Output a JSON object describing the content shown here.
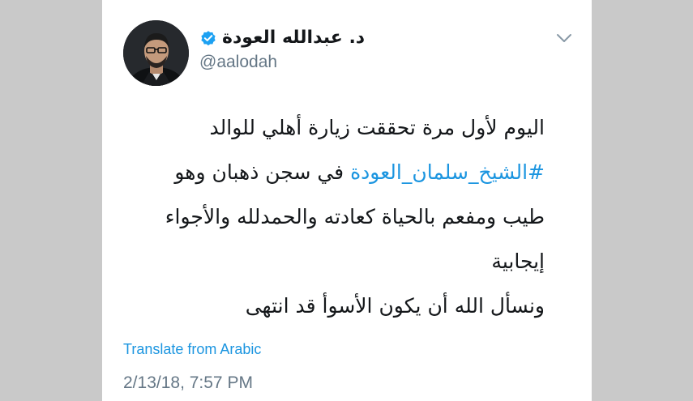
{
  "tweet": {
    "author_name": "د. عبدالله العودة",
    "handle": "@aalodah",
    "lines": [
      {
        "text": "اليوم لأول مرة تحققت زيارة أهلي للوالد"
      },
      {
        "hashtag": "#الشيخ_سلمان_العودة",
        "text": " في سجن ذهبان وهو"
      },
      {
        "text": "طيب ومفعم بالحياة كعادته والحمدلله والأجواء"
      },
      {
        "text": "إيجابية"
      },
      {
        "text": "ونسأل الله أن يكون الأسوأ قد انتهى"
      }
    ],
    "translate_label": "Translate from Arabic",
    "timestamp": "2/13/18, 7:57 PM"
  },
  "colors": {
    "accent": "#1b95e0",
    "text_primary": "#14171a",
    "text_secondary": "#657786",
    "page_background": "#c9c9c9",
    "card_background": "#ffffff"
  },
  "icons": {
    "verified": "verified-badge-icon",
    "menu": "chevron-down-icon"
  }
}
